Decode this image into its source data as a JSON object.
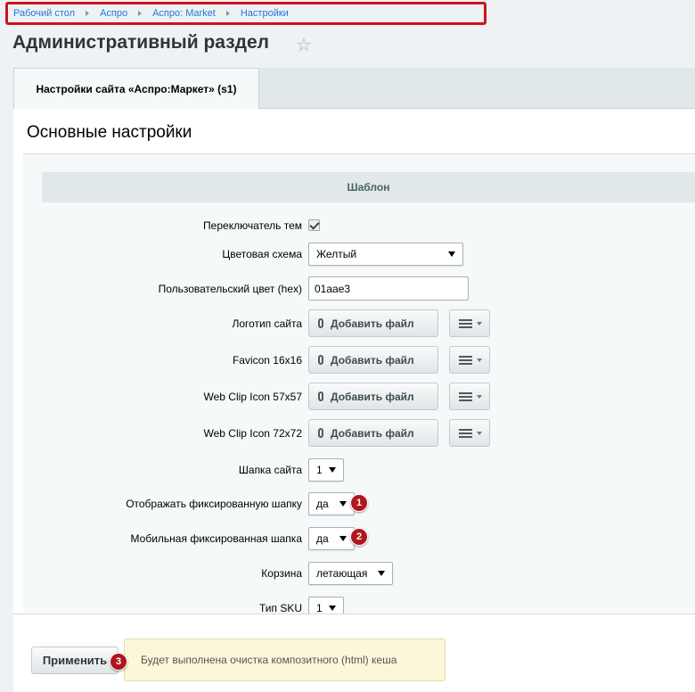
{
  "breadcrumb": [
    "Рабочий стол",
    "Аспро",
    "Аспро: Market",
    "Настройки"
  ],
  "page": {
    "title": "Административный раздел"
  },
  "tabs": [
    {
      "label": "Настройки сайта «Аспро:Маркет» (s1)"
    }
  ],
  "section": {
    "title": "Основные настройки",
    "group_title": "Шаблон"
  },
  "settings": {
    "theme_switch": {
      "label": "Переключатель тем",
      "checked": true
    },
    "color_scheme": {
      "label": "Цветовая схема",
      "value": "Желтый"
    },
    "custom_color": {
      "label": "Пользовательский цвет (hex)",
      "value": "01aae3"
    },
    "logo": {
      "label": "Логотип сайта",
      "button": "Добавить файл"
    },
    "favicon": {
      "label": "Favicon 16x16",
      "button": "Добавить файл"
    },
    "webclip57": {
      "label": "Web Clip Icon 57x57",
      "button": "Добавить файл"
    },
    "webclip72": {
      "label": "Web Clip Icon 72x72",
      "button": "Добавить файл"
    },
    "header": {
      "label": "Шапка сайта",
      "value": "1"
    },
    "fixed_header": {
      "label": "Отображать фиксированную шапку",
      "value": "да",
      "badge": "1"
    },
    "mobile_fixed": {
      "label": "Мобильная фиксированная шапка",
      "value": "да",
      "badge": "2"
    },
    "basket": {
      "label": "Корзина",
      "value": "летающая"
    },
    "sku_type": {
      "label": "Тип SKU",
      "value": "1"
    }
  },
  "footer": {
    "apply_label": "Применить",
    "badge": "3",
    "note": "Будет выполнена очистка композитного (html) кеша"
  },
  "colors": {
    "badge": "#b0161b",
    "link": "#2675d7",
    "highlight_border": "#d0121b",
    "note_bg": "#fdf7d9"
  }
}
